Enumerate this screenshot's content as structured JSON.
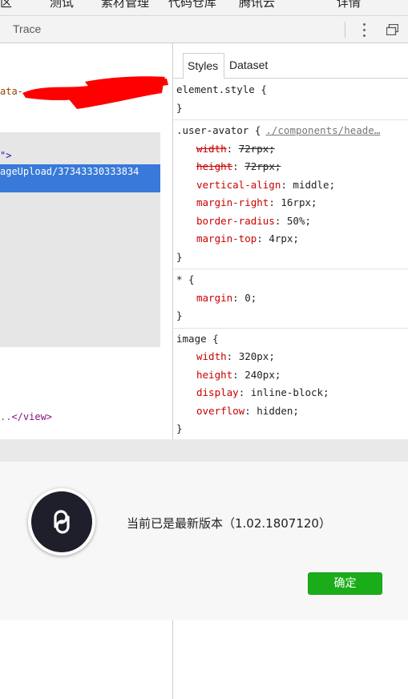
{
  "top_nav": {
    "items": [
      "区",
      "测试",
      "素材管理",
      "代码仓库",
      "腾讯云",
      "详情"
    ]
  },
  "devtools": {
    "trace_tab": "Trace",
    "more_icon": "kebab-menu-icon",
    "undock_icon": "undock-icon"
  },
  "elements": {
    "attr_fragment": "ata-",
    "quote_fragment": "\">",
    "selected_fragment": "ageUpload/37343330333834",
    "view_close_dots": "..",
    "view_close_tag": "</view>"
  },
  "styles_panel": {
    "tabs": [
      "Styles",
      "Dataset"
    ],
    "rules": [
      {
        "selector": "element.style {",
        "source": "",
        "declarations": [],
        "close": "}"
      },
      {
        "selector": ".user-avator {",
        "source": "./components/heade…",
        "declarations": [
          {
            "prop": "width",
            "value": "72rpx;",
            "struck": true
          },
          {
            "prop": "height",
            "value": "72rpx;",
            "struck": true
          },
          {
            "prop": "vertical-align",
            "value": "middle;",
            "struck": false
          },
          {
            "prop": "margin-right",
            "value": "16rpx;",
            "struck": false
          },
          {
            "prop": "border-radius",
            "value": "50%;",
            "struck": false
          },
          {
            "prop": "margin-top",
            "value": "4rpx;",
            "struck": false
          }
        ],
        "close": "}"
      },
      {
        "selector": "* {",
        "source": "",
        "declarations": [
          {
            "prop": "margin",
            "value": "0;",
            "struck": false
          }
        ],
        "close": "}"
      },
      {
        "selector": "image {",
        "source": "",
        "declarations": [
          {
            "prop": "width",
            "value": "320px;",
            "struck": false
          },
          {
            "prop": "height",
            "value": "240px;",
            "struck": false
          },
          {
            "prop": "display",
            "value": "inline-block;",
            "struck": false
          },
          {
            "prop": "overflow",
            "value": "hidden;",
            "struck": false
          }
        ],
        "close": "}"
      }
    ]
  },
  "dialog": {
    "message": "当前已是最新版本（1.02.1807120）",
    "confirm_label": "确定",
    "logo_icon": "mini-program-logo-icon"
  },
  "colors": {
    "selection": "#3879d9",
    "confirm_green": "#1aad19",
    "prop_red": "#c80000",
    "redaction_red": "#ff0000"
  }
}
